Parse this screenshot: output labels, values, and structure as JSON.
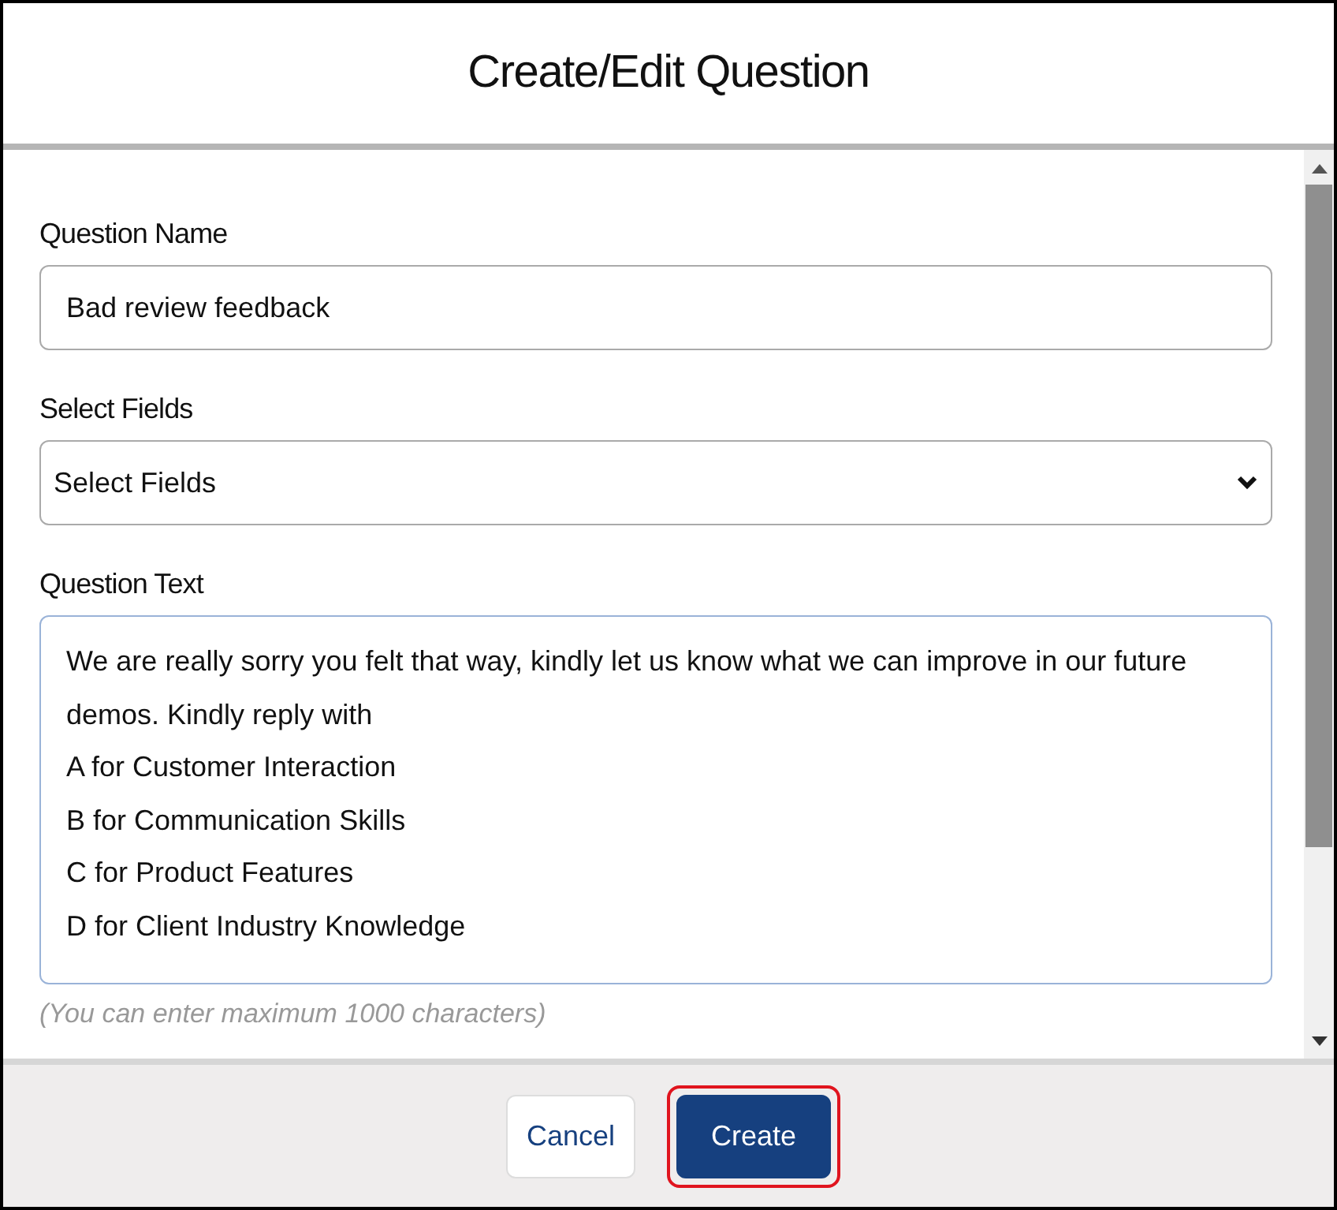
{
  "dialog": {
    "title": "Create/Edit Question"
  },
  "fields": [
    {
      "kind": "text",
      "label": "Question Name",
      "value": "Bad review feedback"
    },
    {
      "kind": "select",
      "label": "Select Fields",
      "value": "Select Fields"
    },
    {
      "kind": "textarea",
      "label": "Question Text",
      "value": "We are really sorry you felt that way, kindly let us know what we can improve in our future demos. Kindly reply with\nA for Customer Interaction\nB for Communication Skills\nC for Product Features\nD for Client Industry Knowledge",
      "hint": "(You can enter maximum 1000 characters)"
    }
  ],
  "buttons": [
    {
      "kind": "secondary",
      "label": "Cancel",
      "highlighted": false
    },
    {
      "kind": "primary",
      "label": "Create",
      "highlighted": true
    }
  ]
}
